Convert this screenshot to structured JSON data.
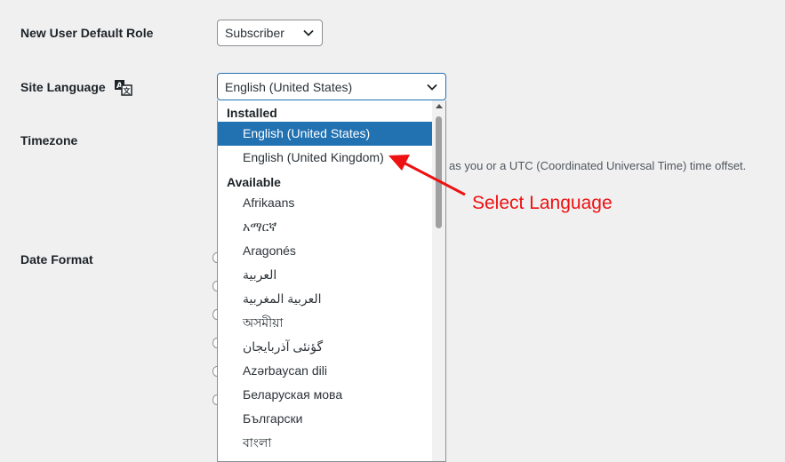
{
  "settings": {
    "default_role": {
      "label": "New User Default Role",
      "value": "Subscriber"
    },
    "site_language": {
      "label": "Site Language",
      "value": "English (United States)"
    },
    "timezone": {
      "label": "Timezone",
      "description_tail": "as you or a UTC (Coordinated Universal Time) time offset."
    },
    "date_format": {
      "label": "Date Format"
    }
  },
  "language_dropdown": {
    "installed_group": "Installed",
    "installed": [
      "English (United States)",
      "English (United Kingdom)"
    ],
    "selected_index": 0,
    "available_group": "Available",
    "available": [
      "Afrikaans",
      "አማርኛ",
      "Aragonés",
      "العربية",
      "العربية المغربية",
      "অসমীয়া",
      "گؤنئی آذربایجان",
      "Azərbaycan dili",
      "Беларуская мова",
      "Български",
      "বাংলা"
    ]
  },
  "annotation": {
    "text": "Select Language",
    "color": "#ee1111"
  },
  "colors": {
    "selected_bg": "#2271b1",
    "page_bg": "#f0f0f1"
  },
  "icons": {
    "language": "translate-icon",
    "dropdown": "chevron-down-icon"
  }
}
